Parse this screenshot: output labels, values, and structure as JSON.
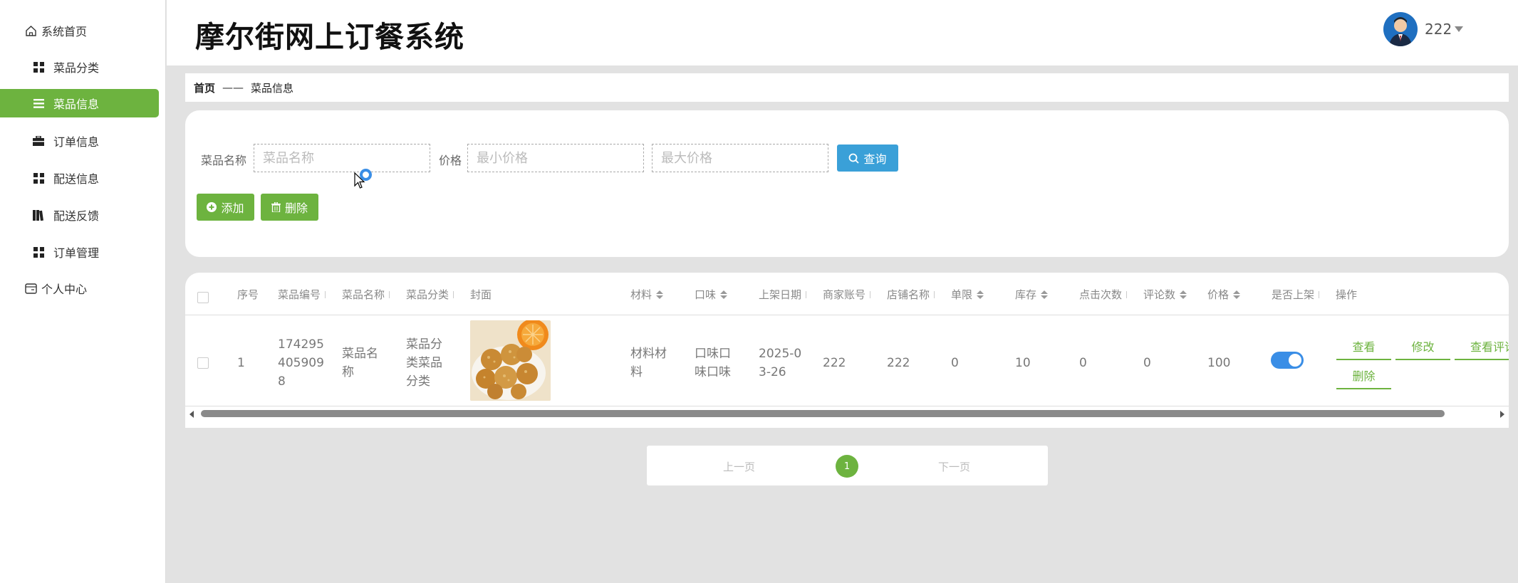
{
  "app": {
    "title": "摩尔街网上订餐系统"
  },
  "user": {
    "name": "222"
  },
  "sidebar": {
    "items": [
      {
        "label": "系统首页",
        "icon": "home-icon"
      },
      {
        "label": "菜品分类",
        "icon": "grid-icon"
      },
      {
        "label": "菜品信息",
        "icon": "list-icon",
        "active": true
      },
      {
        "label": "订单信息",
        "icon": "briefcase-icon"
      },
      {
        "label": "配送信息",
        "icon": "grid-icon"
      },
      {
        "label": "配送反馈",
        "icon": "books-icon"
      },
      {
        "label": "订单管理",
        "icon": "grid-icon"
      },
      {
        "label": "个人中心",
        "icon": "card-icon"
      }
    ]
  },
  "breadcrumb": {
    "home": "首页",
    "separator": "——",
    "current": "菜品信息"
  },
  "search": {
    "name_label": "菜品名称",
    "name_placeholder": "菜品名称",
    "price_label": "价格",
    "min_placeholder": "最小价格",
    "max_placeholder": "最大价格",
    "query_button": "查询",
    "add_button": "添加",
    "delete_button": "删除"
  },
  "table": {
    "headers": {
      "index": "序号",
      "code": "菜品编号",
      "name": "菜品名称",
      "category": "菜品分类",
      "cover": "封面",
      "material": "材料",
      "taste": "口味",
      "date": "上架日期",
      "merchant": "商家账号",
      "shop": "店铺名称",
      "limit": "单限",
      "stock": "库存",
      "clicks": "点击次数",
      "reviews": "评论数",
      "price": "价格",
      "listed": "是否上架",
      "ops": "操作"
    },
    "rows": [
      {
        "index": "1",
        "code_l1": "174295",
        "code_l2": "405909",
        "code_l3": "8",
        "name_l1": "菜品名",
        "name_l2": "称",
        "category_l1": "菜品分",
        "category_l2": "类菜品",
        "category_l3": "分类",
        "material_l1": "材料材",
        "material_l2": "料",
        "taste_l1": "口味口",
        "taste_l2": "味口味",
        "date_l1": "2025-0",
        "date_l2": "3-26",
        "merchant": "222",
        "shop": "222",
        "limit": "0",
        "stock": "10",
        "clicks": "0",
        "reviews": "0",
        "price": "100",
        "listed": true
      }
    ],
    "ops": {
      "view": "查看",
      "edit": "修改",
      "view_reviews": "查看评论",
      "delete": "删除"
    }
  },
  "pagination": {
    "prev": "上一页",
    "current": "1",
    "next": "下一页"
  },
  "colors": {
    "accent_green": "#6db33f",
    "query_blue": "#3aa0d8",
    "toggle_blue": "#3a8ee6"
  }
}
